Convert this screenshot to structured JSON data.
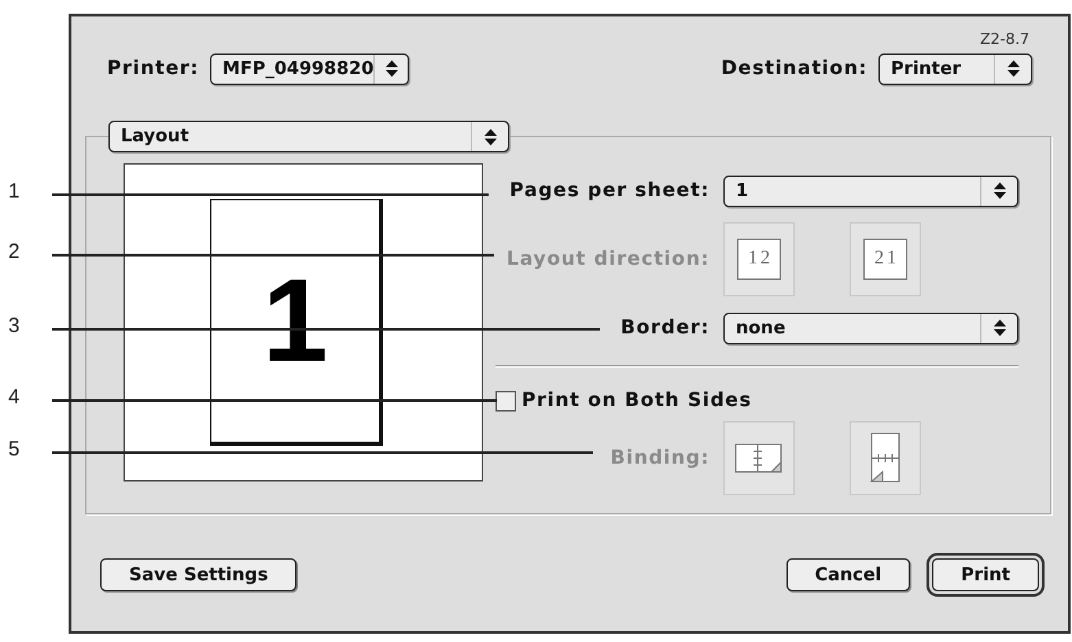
{
  "version": "Z2-8.7",
  "printer": {
    "label": "Printer:",
    "value": "MFP_04998820"
  },
  "destination": {
    "label": "Destination:",
    "value": "Printer"
  },
  "panel": {
    "value": "Layout"
  },
  "preview": {
    "page_number": "1"
  },
  "settings": [
    {
      "kind": "select",
      "label": "Pages per sheet:",
      "value": "1",
      "disabled": false
    },
    {
      "kind": "icons",
      "label": "Layout direction:",
      "disabled": true,
      "options": [
        {
          "kind": "order",
          "pages": [
            "1",
            "2"
          ]
        },
        {
          "kind": "order",
          "pages": [
            "2",
            "1"
          ]
        }
      ]
    },
    {
      "kind": "select",
      "label": "Border:",
      "value": "none",
      "disabled": false
    },
    {
      "kind": "checkbox",
      "label": "Print on Both Sides",
      "checked": false
    },
    {
      "kind": "icons",
      "label": "Binding:",
      "disabled": true,
      "options": [
        {
          "kind": "long-edge"
        },
        {
          "kind": "short-edge"
        }
      ]
    }
  ],
  "callouts": [
    "1",
    "2",
    "3",
    "4",
    "5"
  ],
  "buttons": [
    {
      "label": "Save Settings",
      "default": false
    },
    {
      "label": "Cancel",
      "default": false
    },
    {
      "label": "Print",
      "default": true
    }
  ]
}
